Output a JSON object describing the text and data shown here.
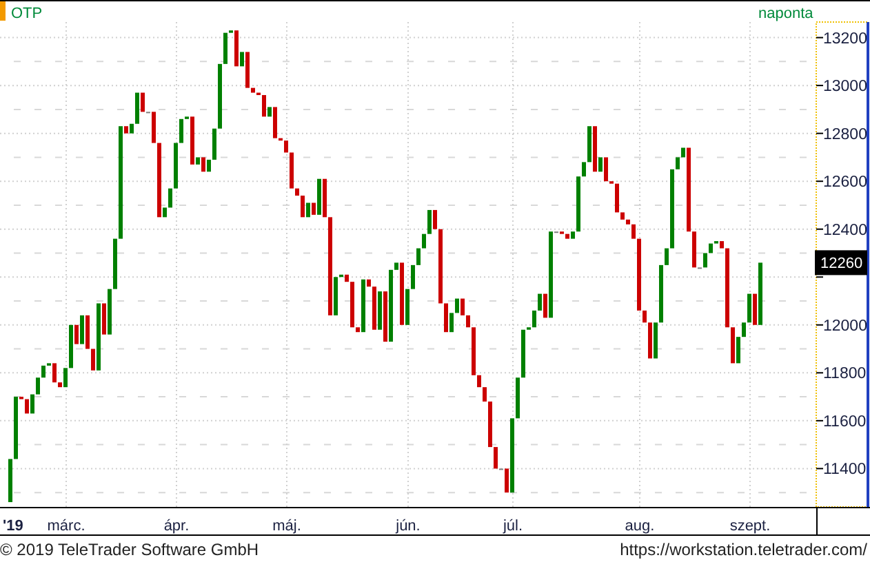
{
  "chart": {
    "symbol": "OTP",
    "interval": "naponta",
    "last_price": "12260",
    "price_labels": [
      "13200",
      "13000",
      "12800",
      "12600",
      "12400",
      "12000",
      "11800",
      "11600",
      "11400"
    ],
    "date_labels": [
      "'19",
      "márc.",
      "ápr.",
      "máj.",
      "jún.",
      "júl.",
      "aug.",
      "szept."
    ]
  },
  "footer": {
    "copyright": "© 2019 TeleTrader Software GmbH",
    "url": "https://workstation.teletrader.com/"
  }
}
